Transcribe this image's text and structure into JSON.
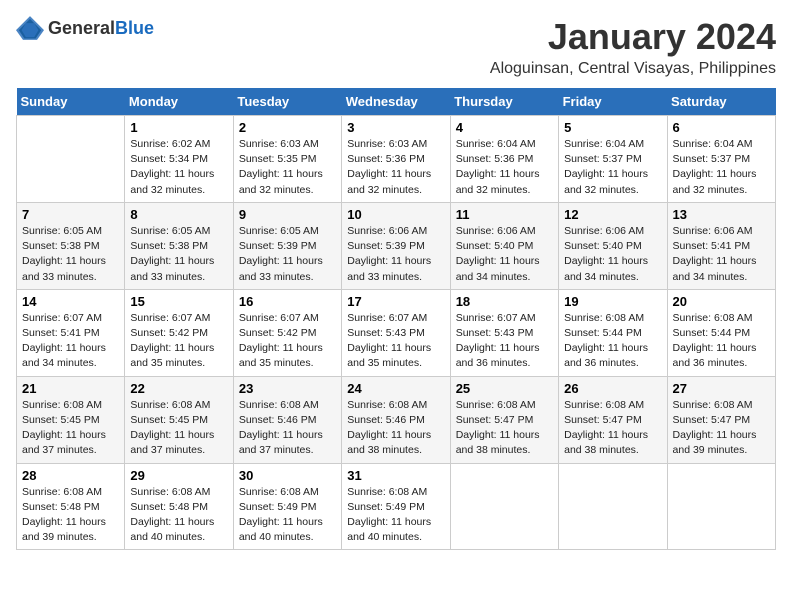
{
  "header": {
    "logo_general": "General",
    "logo_blue": "Blue",
    "month_year": "January 2024",
    "location": "Aloguinsan, Central Visayas, Philippines"
  },
  "days_of_week": [
    "Sunday",
    "Monday",
    "Tuesday",
    "Wednesday",
    "Thursday",
    "Friday",
    "Saturday"
  ],
  "weeks": [
    [
      {
        "day": "",
        "info": ""
      },
      {
        "day": "1",
        "info": "Sunrise: 6:02 AM\nSunset: 5:34 PM\nDaylight: 11 hours\nand 32 minutes."
      },
      {
        "day": "2",
        "info": "Sunrise: 6:03 AM\nSunset: 5:35 PM\nDaylight: 11 hours\nand 32 minutes."
      },
      {
        "day": "3",
        "info": "Sunrise: 6:03 AM\nSunset: 5:36 PM\nDaylight: 11 hours\nand 32 minutes."
      },
      {
        "day": "4",
        "info": "Sunrise: 6:04 AM\nSunset: 5:36 PM\nDaylight: 11 hours\nand 32 minutes."
      },
      {
        "day": "5",
        "info": "Sunrise: 6:04 AM\nSunset: 5:37 PM\nDaylight: 11 hours\nand 32 minutes."
      },
      {
        "day": "6",
        "info": "Sunrise: 6:04 AM\nSunset: 5:37 PM\nDaylight: 11 hours\nand 32 minutes."
      }
    ],
    [
      {
        "day": "7",
        "info": "Sunrise: 6:05 AM\nSunset: 5:38 PM\nDaylight: 11 hours\nand 33 minutes."
      },
      {
        "day": "8",
        "info": "Sunrise: 6:05 AM\nSunset: 5:38 PM\nDaylight: 11 hours\nand 33 minutes."
      },
      {
        "day": "9",
        "info": "Sunrise: 6:05 AM\nSunset: 5:39 PM\nDaylight: 11 hours\nand 33 minutes."
      },
      {
        "day": "10",
        "info": "Sunrise: 6:06 AM\nSunset: 5:39 PM\nDaylight: 11 hours\nand 33 minutes."
      },
      {
        "day": "11",
        "info": "Sunrise: 6:06 AM\nSunset: 5:40 PM\nDaylight: 11 hours\nand 34 minutes."
      },
      {
        "day": "12",
        "info": "Sunrise: 6:06 AM\nSunset: 5:40 PM\nDaylight: 11 hours\nand 34 minutes."
      },
      {
        "day": "13",
        "info": "Sunrise: 6:06 AM\nSunset: 5:41 PM\nDaylight: 11 hours\nand 34 minutes."
      }
    ],
    [
      {
        "day": "14",
        "info": "Sunrise: 6:07 AM\nSunset: 5:41 PM\nDaylight: 11 hours\nand 34 minutes."
      },
      {
        "day": "15",
        "info": "Sunrise: 6:07 AM\nSunset: 5:42 PM\nDaylight: 11 hours\nand 35 minutes."
      },
      {
        "day": "16",
        "info": "Sunrise: 6:07 AM\nSunset: 5:42 PM\nDaylight: 11 hours\nand 35 minutes."
      },
      {
        "day": "17",
        "info": "Sunrise: 6:07 AM\nSunset: 5:43 PM\nDaylight: 11 hours\nand 35 minutes."
      },
      {
        "day": "18",
        "info": "Sunrise: 6:07 AM\nSunset: 5:43 PM\nDaylight: 11 hours\nand 36 minutes."
      },
      {
        "day": "19",
        "info": "Sunrise: 6:08 AM\nSunset: 5:44 PM\nDaylight: 11 hours\nand 36 minutes."
      },
      {
        "day": "20",
        "info": "Sunrise: 6:08 AM\nSunset: 5:44 PM\nDaylight: 11 hours\nand 36 minutes."
      }
    ],
    [
      {
        "day": "21",
        "info": "Sunrise: 6:08 AM\nSunset: 5:45 PM\nDaylight: 11 hours\nand 37 minutes."
      },
      {
        "day": "22",
        "info": "Sunrise: 6:08 AM\nSunset: 5:45 PM\nDaylight: 11 hours\nand 37 minutes."
      },
      {
        "day": "23",
        "info": "Sunrise: 6:08 AM\nSunset: 5:46 PM\nDaylight: 11 hours\nand 37 minutes."
      },
      {
        "day": "24",
        "info": "Sunrise: 6:08 AM\nSunset: 5:46 PM\nDaylight: 11 hours\nand 38 minutes."
      },
      {
        "day": "25",
        "info": "Sunrise: 6:08 AM\nSunset: 5:47 PM\nDaylight: 11 hours\nand 38 minutes."
      },
      {
        "day": "26",
        "info": "Sunrise: 6:08 AM\nSunset: 5:47 PM\nDaylight: 11 hours\nand 38 minutes."
      },
      {
        "day": "27",
        "info": "Sunrise: 6:08 AM\nSunset: 5:47 PM\nDaylight: 11 hours\nand 39 minutes."
      }
    ],
    [
      {
        "day": "28",
        "info": "Sunrise: 6:08 AM\nSunset: 5:48 PM\nDaylight: 11 hours\nand 39 minutes."
      },
      {
        "day": "29",
        "info": "Sunrise: 6:08 AM\nSunset: 5:48 PM\nDaylight: 11 hours\nand 40 minutes."
      },
      {
        "day": "30",
        "info": "Sunrise: 6:08 AM\nSunset: 5:49 PM\nDaylight: 11 hours\nand 40 minutes."
      },
      {
        "day": "31",
        "info": "Sunrise: 6:08 AM\nSunset: 5:49 PM\nDaylight: 11 hours\nand 40 minutes."
      },
      {
        "day": "",
        "info": ""
      },
      {
        "day": "",
        "info": ""
      },
      {
        "day": "",
        "info": ""
      }
    ]
  ]
}
